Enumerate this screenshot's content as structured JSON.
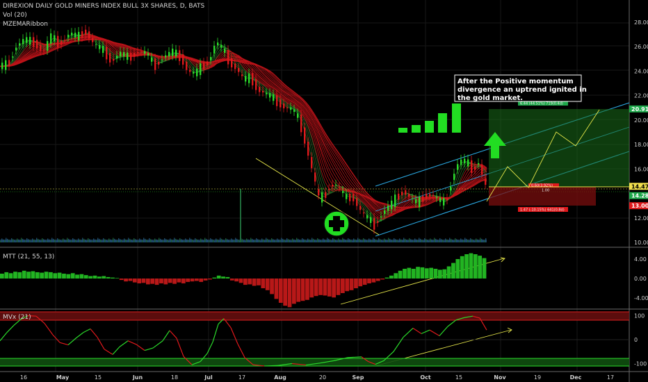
{
  "chart_data": {
    "type": "candlestick",
    "symbol_title": "DIREXION DAILY GOLD MINERS INDEX BULL 3X SHARES, D, BATS",
    "indicators": [
      "Vol (20)",
      "MZEMARibbon"
    ],
    "x_ticks": [
      "16",
      "May",
      "15",
      "Jun",
      "18",
      "Jul",
      "17",
      "Aug",
      "20",
      "Sep",
      "Oct",
      "15",
      "Nov",
      "19",
      "Dec",
      "17"
    ],
    "price_axis": {
      "ticks": [
        "28.00",
        "26.00",
        "24.00",
        "22.00",
        "20.00",
        "18.00",
        "16.00",
        "12.00",
        "10.00"
      ],
      "ylim": [
        10,
        28.8
      ]
    },
    "price_tags": [
      {
        "label": "20.91",
        "value": 20.91,
        "color": "#1ea84a"
      },
      {
        "label": "14.47",
        "value": 14.47,
        "color": "#f4e04d"
      },
      {
        "label": "14.28",
        "value": 14.28,
        "color": "#1ea84a"
      },
      {
        "label": "13.00",
        "value": 13.0,
        "color": "#e0191c"
      }
    ],
    "price_points": [
      {
        "x": 0,
        "y": 24.4
      },
      {
        "x": 12,
        "y": 24.6
      },
      {
        "x": 22,
        "y": 26.0
      },
      {
        "x": 35,
        "y": 26.6
      },
      {
        "x": 50,
        "y": 26.3
      },
      {
        "x": 62,
        "y": 25.5
      },
      {
        "x": 72,
        "y": 26.9
      },
      {
        "x": 85,
        "y": 26.2
      },
      {
        "x": 100,
        "y": 27.1
      },
      {
        "x": 112,
        "y": 26.8
      },
      {
        "x": 122,
        "y": 27.3
      },
      {
        "x": 135,
        "y": 26.2
      },
      {
        "x": 148,
        "y": 25.7
      },
      {
        "x": 160,
        "y": 24.8
      },
      {
        "x": 172,
        "y": 25.5
      },
      {
        "x": 185,
        "y": 25.1
      },
      {
        "x": 198,
        "y": 25.6
      },
      {
        "x": 210,
        "y": 25.5
      },
      {
        "x": 222,
        "y": 24.4
      },
      {
        "x": 235,
        "y": 25.2
      },
      {
        "x": 248,
        "y": 25.6
      },
      {
        "x": 260,
        "y": 25.1
      },
      {
        "x": 270,
        "y": 24.0
      },
      {
        "x": 280,
        "y": 23.8
      },
      {
        "x": 290,
        "y": 24.4
      },
      {
        "x": 300,
        "y": 24.8
      },
      {
        "x": 310,
        "y": 26.4
      },
      {
        "x": 320,
        "y": 25.8
      },
      {
        "x": 330,
        "y": 24.7
      },
      {
        "x": 340,
        "y": 24.2
      },
      {
        "x": 350,
        "y": 23.3
      },
      {
        "x": 360,
        "y": 23.5
      },
      {
        "x": 370,
        "y": 22.5
      },
      {
        "x": 380,
        "y": 22.2
      },
      {
        "x": 390,
        "y": 21.9
      },
      {
        "x": 400,
        "y": 21.4
      },
      {
        "x": 410,
        "y": 21.0
      },
      {
        "x": 420,
        "y": 20.9
      },
      {
        "x": 430,
        "y": 20.0
      },
      {
        "x": 440,
        "y": 17.9
      },
      {
        "x": 450,
        "y": 15.6
      },
      {
        "x": 458,
        "y": 13.6
      },
      {
        "x": 466,
        "y": 13.8
      },
      {
        "x": 474,
        "y": 14.6
      },
      {
        "x": 482,
        "y": 14.8
      },
      {
        "x": 490,
        "y": 14.2
      },
      {
        "x": 498,
        "y": 13.6
      },
      {
        "x": 506,
        "y": 13.8
      },
      {
        "x": 514,
        "y": 13.0
      },
      {
        "x": 522,
        "y": 12.3
      },
      {
        "x": 530,
        "y": 11.9
      },
      {
        "x": 538,
        "y": 11.4
      },
      {
        "x": 546,
        "y": 12.1
      },
      {
        "x": 554,
        "y": 12.7
      },
      {
        "x": 562,
        "y": 13.1
      },
      {
        "x": 570,
        "y": 13.7
      },
      {
        "x": 580,
        "y": 14.2
      },
      {
        "x": 590,
        "y": 13.6
      },
      {
        "x": 600,
        "y": 13.2
      },
      {
        "x": 610,
        "y": 13.8
      },
      {
        "x": 620,
        "y": 13.9
      },
      {
        "x": 630,
        "y": 13.5
      },
      {
        "x": 640,
        "y": 13.2
      },
      {
        "x": 648,
        "y": 14.8
      },
      {
        "x": 656,
        "y": 16.3
      },
      {
        "x": 664,
        "y": 16.7
      },
      {
        "x": 672,
        "y": 16.5
      },
      {
        "x": 680,
        "y": 15.9
      },
      {
        "x": 688,
        "y": 16.6
      },
      {
        "x": 696,
        "y": 14.9
      },
      {
        "x": 700,
        "y": 14.28
      }
    ],
    "mtt": {
      "label": "MTT (21, 55, 13)",
      "ticks": [
        "4.00",
        "0.00",
        "-4.00"
      ],
      "ylim": [
        -6.2,
        6.0
      ],
      "values": [
        1.0,
        1.3,
        1.1,
        1.4,
        1.3,
        1.6,
        1.4,
        1.5,
        1.3,
        1.2,
        1.4,
        1.3,
        1.1,
        1.2,
        1.0,
        0.9,
        1.1,
        0.8,
        0.9,
        0.7,
        0.5,
        0.6,
        0.4,
        0.5,
        0.3,
        0.2,
        0.1,
        -0.3,
        -0.6,
        -0.5,
        -0.8,
        -1.0,
        -0.9,
        -1.2,
        -1.1,
        -1.3,
        -1.0,
        -1.2,
        -0.9,
        -1.1,
        -0.8,
        -1.0,
        -0.7,
        -0.6,
        -0.5,
        -0.7,
        -0.4,
        -0.2,
        0.2,
        0.6,
        0.4,
        0.3,
        -0.4,
        -0.6,
        -0.9,
        -1.3,
        -1.2,
        -1.5,
        -1.4,
        -2.0,
        -2.4,
        -3.2,
        -4.2,
        -5.0,
        -5.6,
        -5.9,
        -5.2,
        -4.8,
        -4.6,
        -4.4,
        -3.9,
        -3.6,
        -3.4,
        -3.5,
        -3.7,
        -3.9,
        -3.4,
        -3.0,
        -2.6,
        -2.4,
        -2.0,
        -1.6,
        -1.3,
        -1.0,
        -0.8,
        -0.5,
        -0.2,
        0.2,
        0.6,
        1.1,
        1.6,
        2.0,
        2.2,
        2.0,
        2.4,
        2.3,
        2.1,
        2.2,
        2.0,
        1.8,
        1.9,
        2.5,
        3.2,
        4.0,
        4.6,
        5.0,
        5.2,
        5.0,
        4.7,
        4.2
      ]
    },
    "mvx": {
      "label": "MVx (21)",
      "ticks": [
        "100",
        "0",
        "-100"
      ],
      "ylim": [
        -122,
        118
      ],
      "points": [
        [
          0,
          -5
        ],
        [
          10,
          30
        ],
        [
          20,
          60
        ],
        [
          30,
          85
        ],
        [
          40,
          100
        ],
        [
          52,
          98
        ],
        [
          64,
          68
        ],
        [
          76,
          20
        ],
        [
          86,
          -12
        ],
        [
          98,
          -22
        ],
        [
          110,
          8
        ],
        [
          120,
          30
        ],
        [
          130,
          45
        ],
        [
          140,
          10
        ],
        [
          150,
          -40
        ],
        [
          162,
          -62
        ],
        [
          172,
          -30
        ],
        [
          184,
          -5
        ],
        [
          196,
          -20
        ],
        [
          208,
          -45
        ],
        [
          220,
          -35
        ],
        [
          234,
          -5
        ],
        [
          244,
          38
        ],
        [
          254,
          6
        ],
        [
          264,
          -70
        ],
        [
          276,
          -105
        ],
        [
          288,
          -92
        ],
        [
          298,
          -58
        ],
        [
          306,
          -10
        ],
        [
          314,
          65
        ],
        [
          322,
          88
        ],
        [
          332,
          50
        ],
        [
          342,
          -18
        ],
        [
          352,
          -75
        ],
        [
          364,
          -105
        ],
        [
          380,
          -110
        ],
        [
          400,
          -108
        ],
        [
          420,
          -100
        ],
        [
          440,
          -106
        ],
        [
          460,
          -98
        ],
        [
          480,
          -88
        ],
        [
          500,
          -75
        ],
        [
          520,
          -72
        ],
        [
          530,
          -92
        ],
        [
          540,
          -103
        ],
        [
          552,
          -88
        ],
        [
          566,
          -50
        ],
        [
          580,
          10
        ],
        [
          594,
          48
        ],
        [
          606,
          25
        ],
        [
          618,
          40
        ],
        [
          632,
          16
        ],
        [
          644,
          55
        ],
        [
          656,
          82
        ],
        [
          668,
          92
        ],
        [
          680,
          98
        ],
        [
          690,
          90
        ],
        [
          700,
          40
        ]
      ]
    },
    "annotation_text": [
      "After the Positive momentum",
      "divergence an uptrend ignited in",
      "the gold market."
    ],
    "projection_box_labels": {
      "top": "6.44 (44.51%) 719(0.4d)",
      "mid_1": "0.60(3.92%)",
      "mid_2": "1.00",
      "bottom": "1.47 (-10.15%) 641(0.8d)"
    }
  },
  "colors": {
    "background": "#000000",
    "up": "#2bdc2b",
    "down": "#e0191c",
    "ribbon": "#c0141a",
    "channel": "#2aa7e0",
    "trendline": "#e8e84a",
    "grid": "#1a1a1a"
  }
}
